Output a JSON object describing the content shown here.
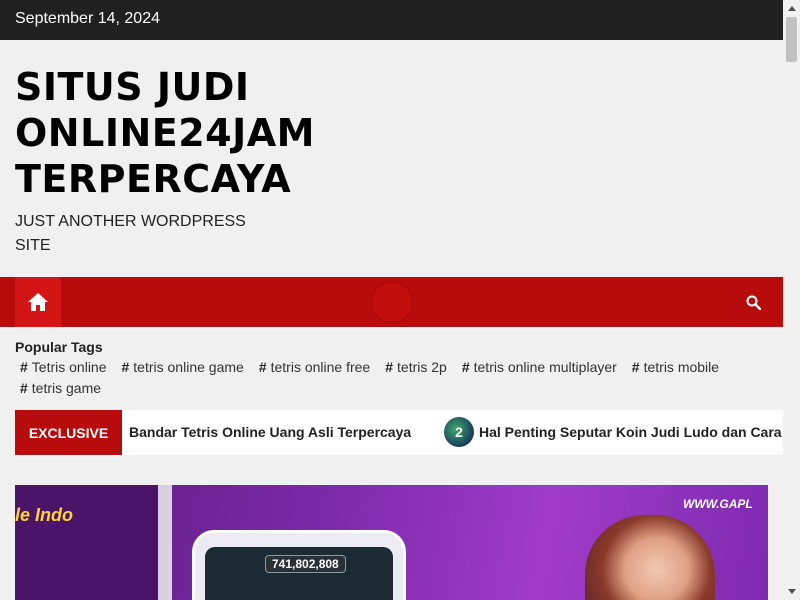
{
  "topbar": {
    "date": "September 14, 2024"
  },
  "branding": {
    "title_lines": [
      "SITUS JUDI",
      "ONLINE24JAM",
      "TERPERCAYA"
    ],
    "description": "JUST ANOTHER WORDPRESS SITE"
  },
  "nav": {
    "home_icon": "home-icon",
    "search_icon": "search-icon",
    "accent": "#b80b0b"
  },
  "tags": {
    "title": "Popular Tags",
    "hash": "#",
    "items": [
      "Tetris online",
      "tetris online game",
      "tetris online free",
      "tetris 2p",
      "tetris online multiplayer",
      "tetris mobile",
      "tetris game"
    ]
  },
  "ticker": {
    "label": "EXCLUSIVE",
    "items": [
      "Bandar Tetris Online Uang Asli Terpercaya",
      "Hal Penting Seputar Koin Judi Ludo dan Cara Mendapatkannya"
    ],
    "thumb_number": "2"
  },
  "hero": {
    "left_title": "le Indo",
    "url": "WWW.GAPL",
    "score": "741,802,808"
  }
}
